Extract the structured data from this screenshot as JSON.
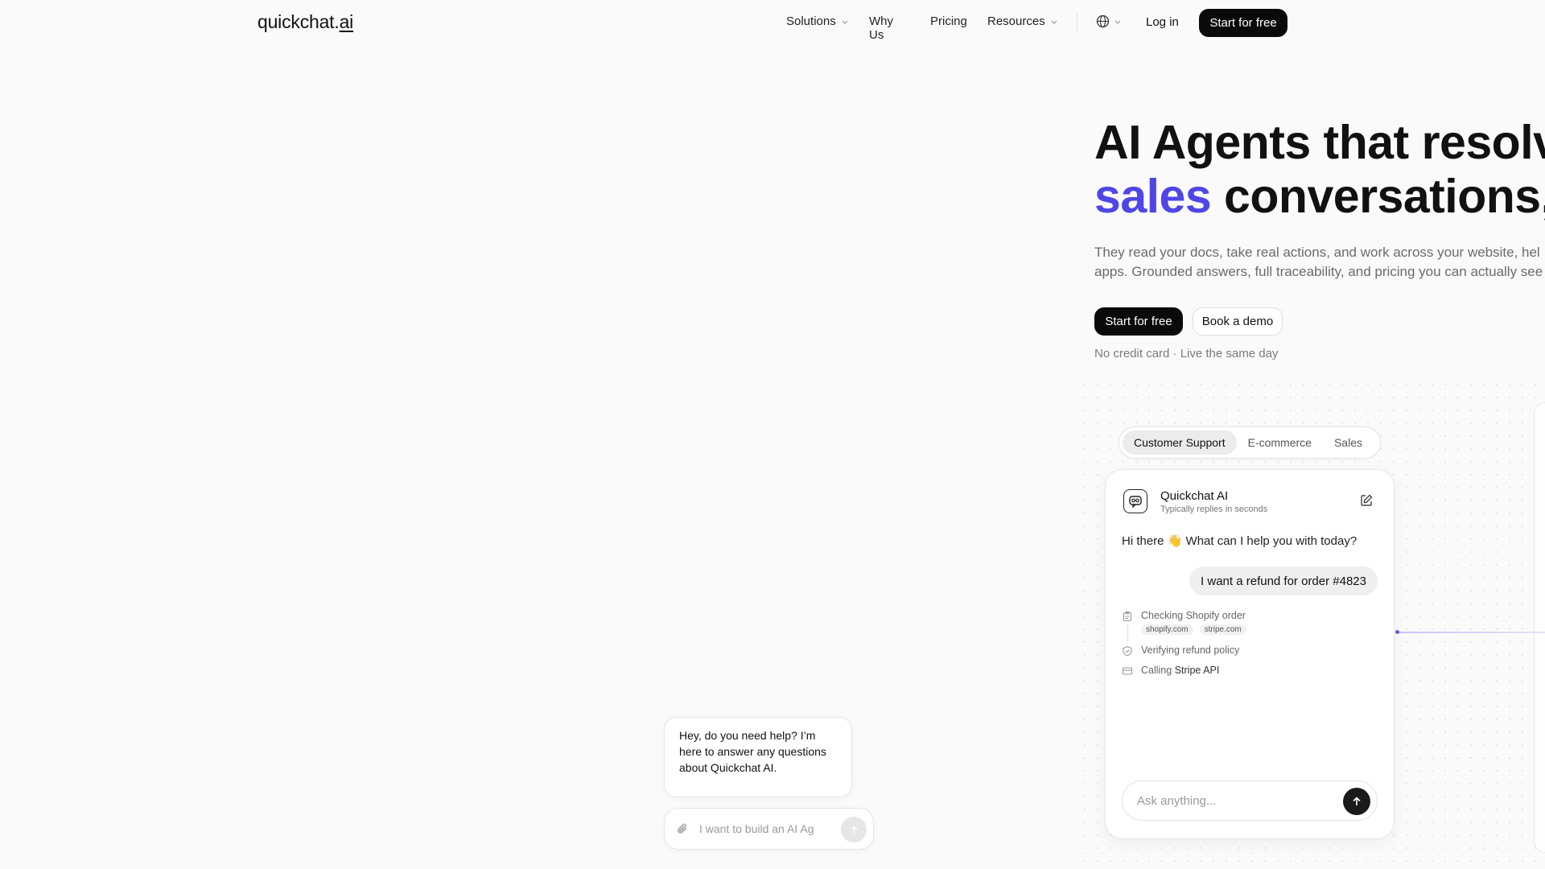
{
  "header": {
    "logo_main": "quickchat.",
    "logo_suffix": "ai",
    "nav": [
      {
        "label": "Solutions",
        "has_dropdown": true
      },
      {
        "label": "Why Us",
        "has_dropdown": false
      },
      {
        "label": "Pricing",
        "has_dropdown": false
      },
      {
        "label": "Resources",
        "has_dropdown": true
      }
    ],
    "language_icon": "globe-icon",
    "login_label": "Log in",
    "cta_label": "Start for free"
  },
  "hero": {
    "title_line1": "AI Agents that resolve",
    "title_accent": "sales",
    "title_line2_rest": " conversations, n",
    "subtitle_line1": "They read your docs, take real actions, and work across your website, hel",
    "subtitle_line2": "apps. Grounded answers, full traceability, and pricing you can actually see",
    "primary_cta": "Start for free",
    "secondary_cta": "Book a demo",
    "note": "No credit card · Live the same day"
  },
  "demo": {
    "tabs": [
      {
        "label": "Customer Support",
        "active": true
      },
      {
        "label": "E-commerce",
        "active": false
      },
      {
        "label": "Sales",
        "active": false
      }
    ],
    "chat": {
      "bot_name": "Quickchat AI",
      "bot_status": "Typically replies in seconds",
      "greeting": "Hi there 👋 What can I help you with today?",
      "user_message": "I want a refund for order #4823",
      "steps": [
        {
          "icon": "clipboard-icon",
          "text": "Checking Shopify order",
          "chips": [
            "shopify.com",
            "stripe.com"
          ]
        },
        {
          "icon": "shield-icon",
          "text": "Verifying refund policy"
        },
        {
          "icon": "card-icon",
          "prefix": "Calling",
          "text": "Stripe API"
        }
      ],
      "input_placeholder": "Ask anything..."
    }
  },
  "widget": {
    "message": "Hey, do you need help? I’m here to answer any questions about Quickchat AI.",
    "input_placeholder": "I want to build an AI Ag"
  },
  "colors": {
    "accent": "#4f46e5",
    "background": "#fafafa",
    "button_dark": "#0a0a0a"
  }
}
